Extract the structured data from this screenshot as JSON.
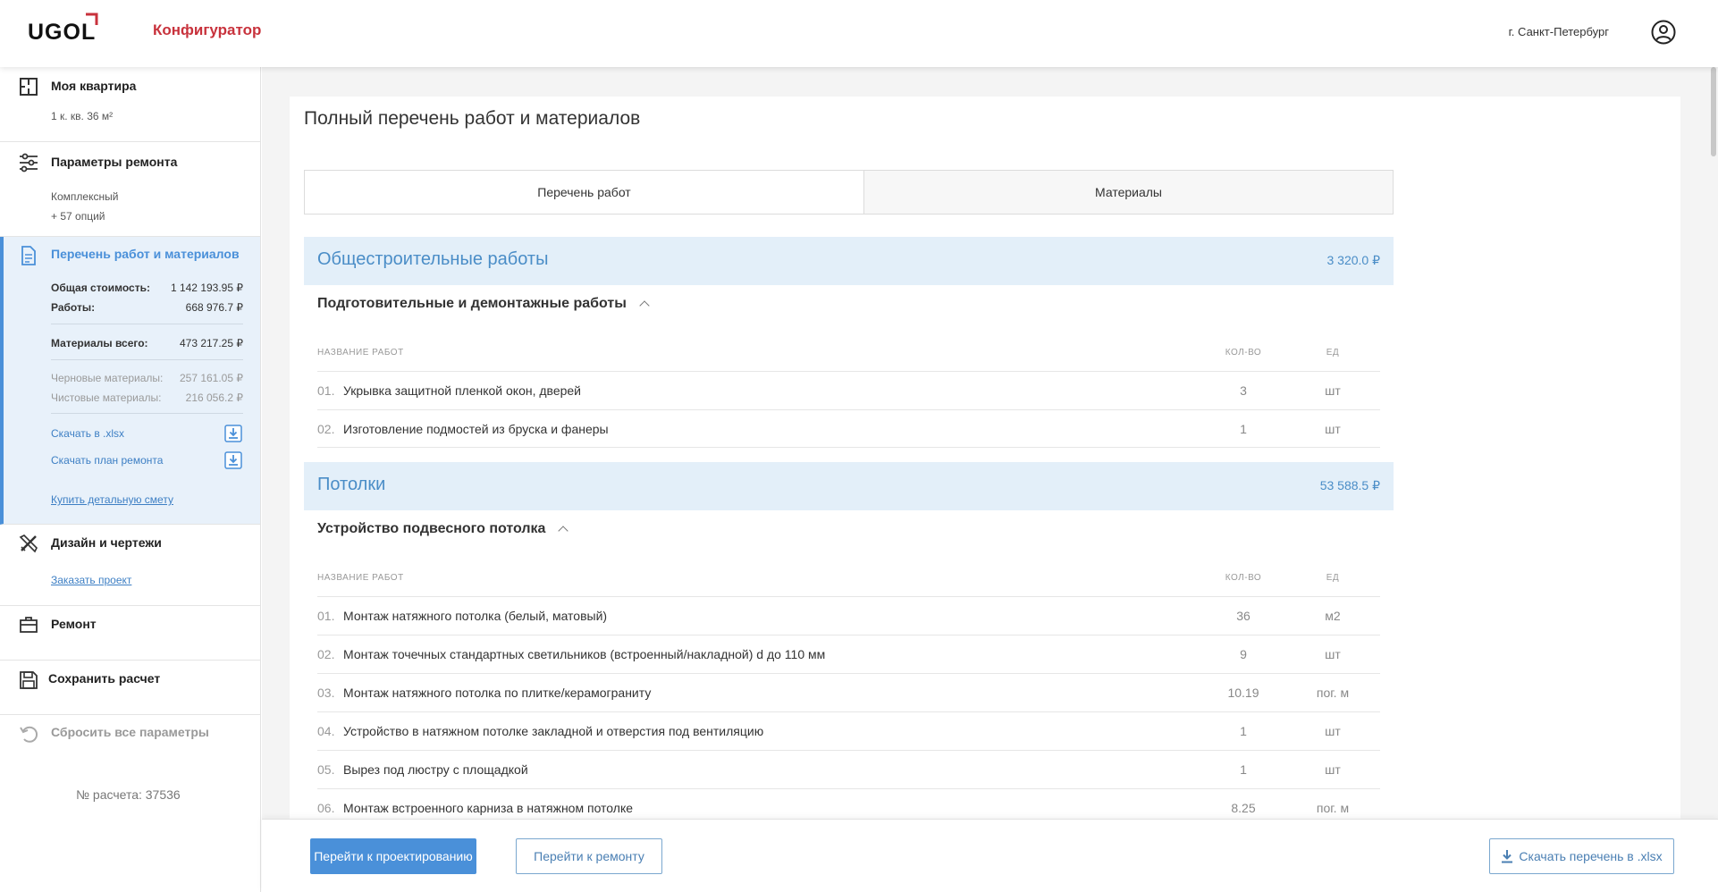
{
  "header": {
    "logo": "UGOL",
    "app_title": "Конфигуратор",
    "city": "г. Санкт-Петербург"
  },
  "sidebar": {
    "apartment": {
      "title": "Моя квартира",
      "subtitle": "1 к. кв. 36 м²"
    },
    "params": {
      "title": "Параметры ремонта",
      "line1": "Комплексный",
      "line2": "+ 57 опций"
    },
    "works": {
      "title": "Перечень работ и материалов",
      "total_label": "Общая стоимость:",
      "total_value": "1 142 193.95 ₽",
      "works_label": "Работы:",
      "works_value": "668 976.7 ₽",
      "materials_label": "Материалы всего:",
      "materials_value": "473 217.25 ₽",
      "rough_label": "Черновые материалы:",
      "rough_value": "257 161.05 ₽",
      "finish_label": "Чистовые материалы:",
      "finish_value": "216 056.2 ₽",
      "download_xlsx": "Скачать в .xlsx",
      "download_plan": "Скачать план ремонта",
      "buy_estimate": "Купить детальную смету"
    },
    "design": {
      "title": "Дизайн и чертежи",
      "order_link": "Заказать проект"
    },
    "repair": {
      "title": "Ремонт"
    },
    "save": {
      "title": "Сохранить расчет"
    },
    "reset": {
      "title": "Сбросить все параметры"
    },
    "calc_number": "№ расчета: 37536"
  },
  "main": {
    "title": "Полный перечень работ и материалов",
    "tabs": [
      "Перечень работ",
      "Материалы"
    ],
    "columns": {
      "name": "НАЗВАНИЕ РАБОТ",
      "qty": "КОЛ-ВО",
      "unit": "ЕД"
    },
    "categories": [
      {
        "name": "Общестроительные работы",
        "total": "3 320.0 ₽",
        "subsection": "Подготовительные и демонтажные работы",
        "rows": [
          {
            "n": "01.",
            "name": "Укрывка защитной пленкой окон, дверей",
            "qty": "3",
            "unit": "шт"
          },
          {
            "n": "02.",
            "name": "Изготовление подмостей из бруска и фанеры",
            "qty": "1",
            "unit": "шт"
          }
        ]
      },
      {
        "name": "Потолки",
        "total": "53 588.5 ₽",
        "subsection": "Устройство подвесного потолка",
        "rows": [
          {
            "n": "01.",
            "name": "Монтаж натяжного потолка (белый, матовый)",
            "qty": "36",
            "unit": "м2"
          },
          {
            "n": "02.",
            "name": "Монтаж точечных стандартных светильников (встроенный/накладной) d до 110 мм",
            "qty": "9",
            "unit": "шт"
          },
          {
            "n": "03.",
            "name": "Монтаж натяжного потолка по плитке/керамограниту",
            "qty": "10.19",
            "unit": "пог. м"
          },
          {
            "n": "04.",
            "name": "Устройство в натяжном потолке закладной и отверстия под вентиляцию",
            "qty": "1",
            "unit": "шт"
          },
          {
            "n": "05.",
            "name": "Вырез под люстру с площадкой",
            "qty": "1",
            "unit": "шт"
          },
          {
            "n": "06.",
            "name": "Монтаж встроенного карниза в натяжном потолке",
            "qty": "8.25",
            "unit": "пог. м"
          }
        ]
      }
    ]
  },
  "bottom": {
    "to_design": "Перейти к проектированию",
    "to_repair": "Перейти к ремонту",
    "download": "Скачать перечень в .xlsx"
  },
  "colors": {
    "accent": "#4a90d9",
    "brand_red": "#c8323c",
    "category_bg": "#e3eff9"
  }
}
